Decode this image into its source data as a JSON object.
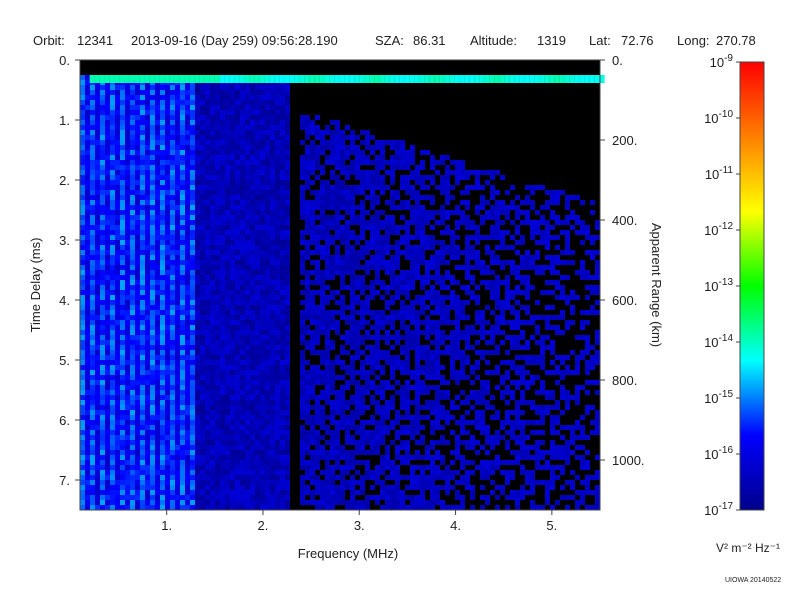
{
  "header": {
    "orbit_label": "Orbit:",
    "orbit": "12341",
    "datetime": "2013-09-16 (Day 259) 09:56:28.190",
    "sza_label": "SZA:",
    "sza": "86.31",
    "altitude_label": "Altitude:",
    "altitude": "1319",
    "lat_label": "Lat:",
    "lat": "72.76",
    "long_label": "Long:",
    "long": "270.78"
  },
  "footer": {
    "credit": "UIOWA 20140522"
  },
  "chart_data": {
    "type": "heatmap",
    "title": "",
    "xlabel": "Frequency (MHz)",
    "ylabel": "Time Delay (ms)",
    "y2label": "Apparent Range (km)",
    "xlim": [
      0.1,
      5.5
    ],
    "ylim": [
      7.5,
      0
    ],
    "x_ticks": [
      1,
      2,
      3,
      4,
      5
    ],
    "x_tick_labels": [
      "1.",
      "2.",
      "3.",
      "4.",
      "5."
    ],
    "y_ticks": [
      0,
      1,
      2,
      3,
      4,
      5,
      6,
      7
    ],
    "y_tick_labels": [
      "0.",
      "1.",
      "2.",
      "3.",
      "4.",
      "5.",
      "6.",
      "7."
    ],
    "y2_ticks": [
      0,
      200,
      400,
      600,
      800,
      1000
    ],
    "y2_tick_labels": [
      "0.",
      "200.",
      "400.",
      "600.",
      "800.",
      "1000."
    ],
    "colorbar": {
      "label": "V² m⁻² Hz⁻¹",
      "log_min": -17,
      "log_max": -9,
      "tick_exponents": [
        -9,
        -10,
        -11,
        -12,
        -13,
        -14,
        -15,
        -16,
        -17
      ],
      "base": "10",
      "colors": [
        "#00008b",
        "#0000ff",
        "#00ffff",
        "#00ff00",
        "#ffff00",
        "#ff8000",
        "#ff0000"
      ]
    },
    "features": [
      {
        "name": "surface reflection",
        "x_range": [
          0.2,
          5.5
        ],
        "delay": 0.3,
        "log_intensity": -15
      },
      {
        "name": "low-frequency vertical lines",
        "x_range": [
          0.1,
          1.3
        ],
        "log_intensity": -15.5
      },
      {
        "name": "background noise",
        "x_range": [
          1.3,
          5.5
        ],
        "log_intensity": -16.3
      }
    ]
  }
}
